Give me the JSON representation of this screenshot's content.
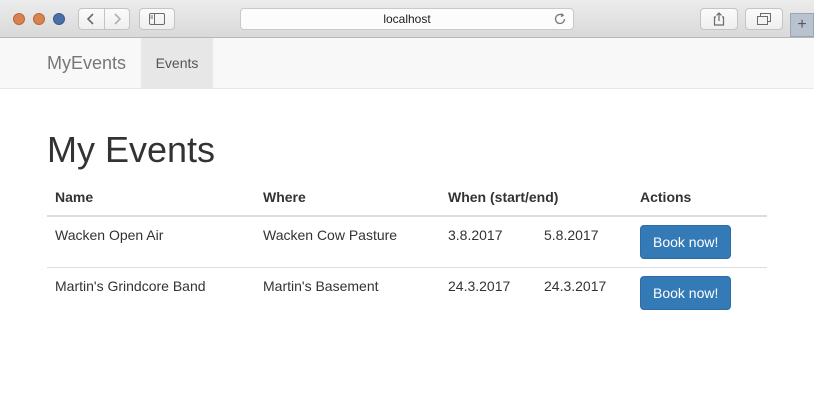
{
  "browser": {
    "address": "localhost"
  },
  "navbar": {
    "brand": "MyEvents",
    "tabs": [
      {
        "label": "Events",
        "active": true
      }
    ]
  },
  "page": {
    "title": "My Events"
  },
  "table": {
    "headers": [
      "Name",
      "Where",
      "When (start/end)",
      "Actions"
    ],
    "rows": [
      {
        "name": "Wacken Open Air",
        "where": "Wacken Cow Pasture",
        "start": "3.8.2017",
        "end": "5.8.2017",
        "action": "Book now!"
      },
      {
        "name": "Martin's Grindcore Band",
        "where": "Martin's Basement",
        "start": "24.3.2017",
        "end": "24.3.2017",
        "action": "Book now!"
      }
    ]
  },
  "colors": {
    "primary_button": "#337ab7",
    "traffic_close": "#d8834f",
    "traffic_minimize": "#d8834f",
    "traffic_zoom": "#4a6fa7"
  },
  "icons": [
    "back-chevron-icon",
    "forward-chevron-icon",
    "sidebar-icon",
    "reload-icon",
    "share-icon",
    "tabs-overview-icon",
    "plus-icon"
  ]
}
